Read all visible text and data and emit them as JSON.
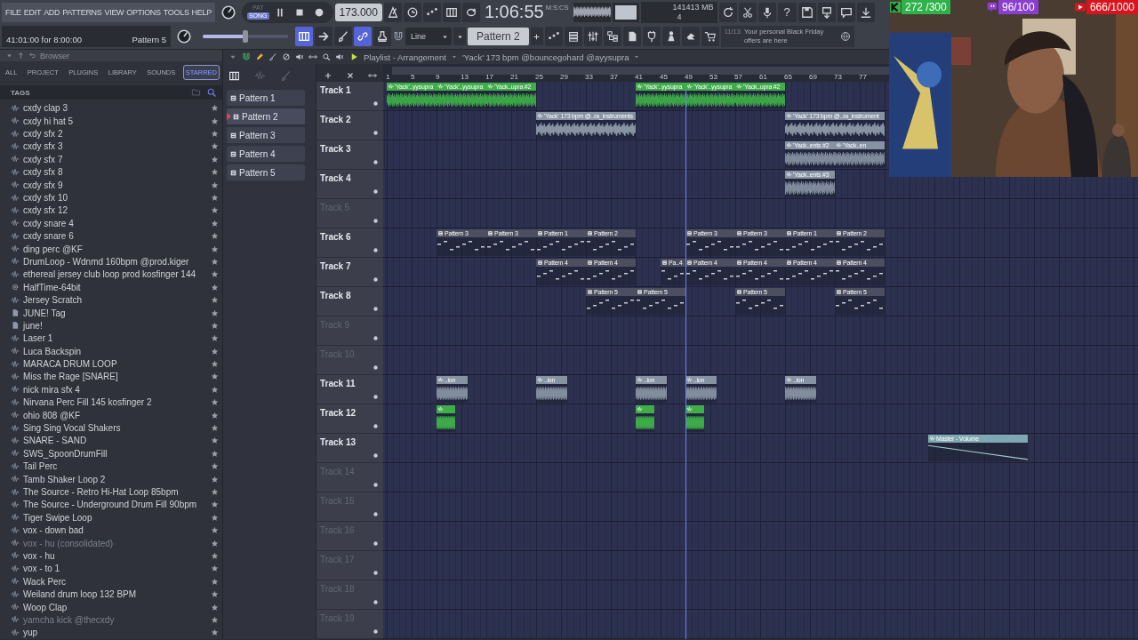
{
  "menu": [
    "FILE",
    "EDIT",
    "ADD",
    "PATTERNS",
    "VIEW",
    "OPTIONS",
    "TOOLS",
    "HELP"
  ],
  "transport": {
    "modes": [
      {
        "label": "PAT",
        "selected": false
      },
      {
        "label": "SONG",
        "selected": true
      }
    ],
    "tempo": "173.000"
  },
  "time": {
    "value": "1:06:55",
    "unit": "M:S:CS"
  },
  "cpu": {
    "voices": "14",
    "memory": "1413 MB",
    "cores": "4"
  },
  "help_label": "?",
  "hint": {
    "text": "41:01:00 for 8:00:00",
    "pattern": "Pattern 5"
  },
  "master_volume": {
    "level": 0.5
  },
  "snap": {
    "value": "Line"
  },
  "pattern_selector": {
    "value": "Pattern 2"
  },
  "news": {
    "date": "11/13",
    "text": "Your personal Black Friday offers are here"
  },
  "counters": [
    {
      "text": "272 /300",
      "color": "#2fb24a"
    },
    {
      "text": "96/100",
      "color": "#8a3fd1"
    },
    {
      "text": "666/1000",
      "color": "#d9141e"
    }
  ],
  "browser": {
    "title": "Browser",
    "tabs": [
      {
        "label": "ALL",
        "selected": false
      },
      {
        "label": "PROJECT",
        "selected": false
      },
      {
        "label": "PLUGINS",
        "selected": false
      },
      {
        "label": "LIBRARY",
        "selected": false
      },
      {
        "label": "SOUNDS",
        "selected": false
      },
      {
        "label": "STARRED",
        "selected": true
      }
    ],
    "section": "TAGS",
    "items": [
      {
        "name": "cxdy clap 3",
        "kind": "audio",
        "dimmed": false
      },
      {
        "name": "cxdy hi hat 5",
        "kind": "audio",
        "dimmed": false
      },
      {
        "name": "cxdy sfx 2",
        "kind": "audio",
        "dimmed": false
      },
      {
        "name": "cxdy sfx 3",
        "kind": "audio",
        "dimmed": false
      },
      {
        "name": "cxdy sfx 7",
        "kind": "audio",
        "dimmed": false
      },
      {
        "name": "cxdy sfx 8",
        "kind": "audio",
        "dimmed": false
      },
      {
        "name": "cxdy sfx 9",
        "kind": "audio",
        "dimmed": false
      },
      {
        "name": "cxdy sfx 10",
        "kind": "audio",
        "dimmed": false
      },
      {
        "name": "cxdy sfx 12",
        "kind": "audio",
        "dimmed": false
      },
      {
        "name": "cxdy snare 4",
        "kind": "audio",
        "dimmed": false
      },
      {
        "name": "cxdy snare 6",
        "kind": "audio",
        "dimmed": false
      },
      {
        "name": "ding perc @KF",
        "kind": "audio",
        "dimmed": false
      },
      {
        "name": "DrumLoop - Wdnmd 160bpm @prod.kiger",
        "kind": "audio",
        "dimmed": false
      },
      {
        "name": "ethereal jersey club loop prod kosfinger 144",
        "kind": "audio",
        "dimmed": false
      },
      {
        "name": "HalfTime-64bit",
        "kind": "plugin",
        "dimmed": false
      },
      {
        "name": "Jersey Scratch",
        "kind": "audio",
        "dimmed": false
      },
      {
        "name": "JUNE! Tag",
        "kind": "mp3",
        "dimmed": false
      },
      {
        "name": "june!",
        "kind": "mp3",
        "dimmed": false
      },
      {
        "name": "Laser 1",
        "kind": "audio",
        "dimmed": false
      },
      {
        "name": "Luca Backspin",
        "kind": "audio",
        "dimmed": false
      },
      {
        "name": "MARACA DRUM LOOP",
        "kind": "audio",
        "dimmed": false
      },
      {
        "name": "Miss the Rage [SNARE]",
        "kind": "audio",
        "dimmed": false
      },
      {
        "name": "nick mira sfx 4",
        "kind": "audio",
        "dimmed": false
      },
      {
        "name": "Nirvana Perc Fill 145 kosfinger 2",
        "kind": "audio",
        "dimmed": false
      },
      {
        "name": "ohio 808 @KF",
        "kind": "audio",
        "dimmed": false
      },
      {
        "name": "Sing Sing Vocal Shakers",
        "kind": "audio",
        "dimmed": false
      },
      {
        "name": "SNARE - SAND",
        "kind": "audio",
        "dimmed": false
      },
      {
        "name": "SWS_SpoonDrumFill",
        "kind": "audio",
        "dimmed": false
      },
      {
        "name": "Tail Perc",
        "kind": "audio",
        "dimmed": false
      },
      {
        "name": "Tamb Shaker Loop 2",
        "kind": "audio",
        "dimmed": false
      },
      {
        "name": "The Source - Retro Hi-Hat Loop 85bpm",
        "kind": "audio",
        "dimmed": false
      },
      {
        "name": "The Source - Underground Drum Fill 90bpm",
        "kind": "audio",
        "dimmed": false
      },
      {
        "name": "Tiger Swipe Loop",
        "kind": "audio",
        "dimmed": false
      },
      {
        "name": "vox - down bad",
        "kind": "audio",
        "dimmed": false
      },
      {
        "name": "vox - hu (consolidated)",
        "kind": "audio",
        "dimmed": true
      },
      {
        "name": "vox - hu",
        "kind": "audio",
        "dimmed": false
      },
      {
        "name": "vox - to 1",
        "kind": "audio",
        "dimmed": false
      },
      {
        "name": "Wack Perc",
        "kind": "audio",
        "dimmed": false
      },
      {
        "name": "Weiland drum loop 132 BPM",
        "kind": "audio",
        "dimmed": false
      },
      {
        "name": "Woop Clap",
        "kind": "audio",
        "dimmed": false
      },
      {
        "name": "yamcha kick @thecxdy",
        "kind": "audio",
        "dimmed": true
      },
      {
        "name": "yup",
        "kind": "audio",
        "dimmed": false
      }
    ]
  },
  "patterns": [
    {
      "name": "Pattern 1",
      "selected": false
    },
    {
      "name": "Pattern 2",
      "selected": true
    },
    {
      "name": "Pattern 3",
      "selected": false
    },
    {
      "name": "Pattern 4",
      "selected": false
    },
    {
      "name": "Pattern 5",
      "selected": false
    }
  ],
  "playlist": {
    "title": "Playlist - Arrangement",
    "song": "'Yack' 173 bpm @bouncegohard @ayysupra",
    "ruler": [
      "1",
      "5",
      "9",
      "13",
      "17",
      "21",
      "25",
      "29",
      "33",
      "37",
      "41",
      "45",
      "49",
      "53",
      "57",
      "61",
      "65",
      "69",
      "73",
      "77"
    ],
    "playhead": {
      "level": 0.4
    },
    "tracks": [
      {
        "name": "Track 1",
        "dimmed": false,
        "clips": [
          {
            "kind": "audio",
            "label": "'Yack'..yysupra",
            "color": "#3fae49"
          },
          {
            "kind": "audio",
            "label": "'Yack'..yysupra",
            "color": "#3fae49"
          },
          {
            "kind": "audio",
            "label": "'Yack..upra #2",
            "color": "#3fae49"
          },
          {
            "kind": "audio",
            "label": "'Yack'..yysupra",
            "color": "#3fae49"
          },
          {
            "kind": "audio",
            "label": "'Yack'..yysupra",
            "color": "#3fae49"
          },
          {
            "kind": "audio",
            "label": "'Yack..upra #2",
            "color": "#3fae49"
          }
        ]
      },
      {
        "name": "Track 2",
        "dimmed": false,
        "clips": [
          {
            "kind": "audio",
            "label": "'Yack' 173 bpm @..ra_instruments",
            "color": "#8793a3"
          },
          {
            "kind": "audio",
            "label": "'Yack' 173 bpm @..ra_instrument",
            "color": "#8793a3"
          }
        ]
      },
      {
        "name": "Track 3",
        "dimmed": false,
        "clips": [
          {
            "kind": "audio",
            "label": "'Yack..ents #2",
            "color": "#8793a3"
          },
          {
            "kind": "audio",
            "label": "'Yack..en",
            "color": "#8793a3"
          }
        ]
      },
      {
        "name": "Track 4",
        "dimmed": false,
        "clips": [
          {
            "kind": "audio",
            "label": "'Yack..ents #3",
            "color": "#8793a3"
          }
        ]
      },
      {
        "name": "Track 5",
        "dimmed": true
      },
      {
        "name": "Track 6",
        "dimmed": false,
        "clips": [
          {
            "kind": "pattern",
            "label": "Pattern 3"
          },
          {
            "kind": "pattern",
            "label": "Pattern 3"
          },
          {
            "kind": "pattern",
            "label": "Pattern 1"
          },
          {
            "kind": "pattern",
            "label": "Pattern 2"
          },
          {
            "kind": "pattern",
            "label": "Pattern 3"
          },
          {
            "kind": "pattern",
            "label": "Pattern 3"
          },
          {
            "kind": "pattern",
            "label": "Pattern 1"
          },
          {
            "kind": "pattern",
            "label": "Pattern 2"
          }
        ]
      },
      {
        "name": "Track 7",
        "dimmed": false,
        "clips": [
          {
            "kind": "pattern",
            "label": "Pattern 4"
          },
          {
            "kind": "pattern",
            "label": "Pattern 4"
          },
          {
            "kind": "pattern",
            "label": "Pa..4"
          },
          {
            "kind": "pattern",
            "label": "Pattern 4"
          },
          {
            "kind": "pattern",
            "label": "Pattern 4"
          },
          {
            "kind": "pattern",
            "label": "Pattern 4"
          },
          {
            "kind": "pattern",
            "label": "Pattern 4"
          }
        ]
      },
      {
        "name": "Track 8",
        "dimmed": false,
        "clips": [
          {
            "kind": "pattern",
            "label": "Pattern 5"
          },
          {
            "kind": "pattern",
            "label": "Pattern 5"
          },
          {
            "kind": "pattern",
            "label": "Pattern 5"
          },
          {
            "kind": "pattern",
            "label": "Pattern 5"
          }
        ]
      },
      {
        "name": "Track 9",
        "dimmed": true
      },
      {
        "name": "Track 10",
        "dimmed": true
      },
      {
        "name": "Track 11",
        "dimmed": false,
        "clips": [
          {
            "kind": "audio",
            "label": "..ion",
            "color": "#8793a3"
          },
          {
            "kind": "audio",
            "label": "..ion",
            "color": "#8793a3"
          },
          {
            "kind": "audio",
            "label": "..ion",
            "color": "#8793a3"
          },
          {
            "kind": "audio",
            "label": "..ion",
            "color": "#8793a3"
          },
          {
            "kind": "audio",
            "label": "..ion",
            "color": "#8793a3"
          }
        ]
      },
      {
        "name": "Track 12",
        "dimmed": false,
        "clips": [
          {
            "kind": "audio",
            "color": "#3fae49"
          },
          {
            "kind": "audio",
            "color": "#3fae49"
          },
          {
            "kind": "audio",
            "color": "#3fae49"
          }
        ]
      },
      {
        "name": "Track 13",
        "dimmed": false,
        "clips": [
          {
            "kind": "automation",
            "label": "Master - Volume"
          }
        ]
      },
      {
        "name": "Track 14",
        "dimmed": true
      },
      {
        "name": "Track 15",
        "dimmed": true
      },
      {
        "name": "Track 16",
        "dimmed": true
      },
      {
        "name": "Track 17",
        "dimmed": true
      },
      {
        "name": "Track 18",
        "dimmed": true
      },
      {
        "name": "Track 19",
        "dimmed": true
      }
    ]
  }
}
